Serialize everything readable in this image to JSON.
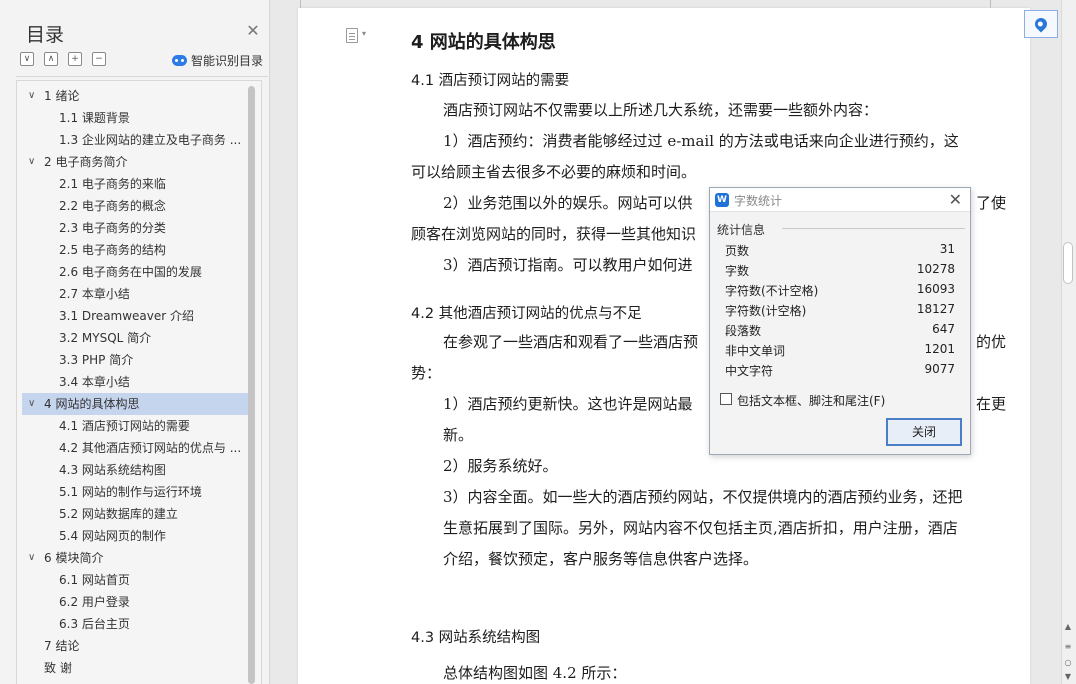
{
  "sidebar": {
    "title": "目录",
    "close_icon": "close-icon",
    "tools": [
      "expand-all-icon",
      "collapse-level-icon",
      "add-heading-icon",
      "remove-heading-icon"
    ],
    "smart_label": "智能识别目录",
    "items": [
      {
        "label": "1   绪论",
        "level": 1,
        "caret": "∨"
      },
      {
        "label": "1.1  课题背景",
        "level": 2
      },
      {
        "label": "1.3  企业网站的建立及电子商务 ...",
        "level": 2
      },
      {
        "label": "2   电子商务简介",
        "level": 1,
        "caret": "∨"
      },
      {
        "label": "2.1  电子商务的来临",
        "level": 2
      },
      {
        "label": "2.2  电子商务的概念",
        "level": 2
      },
      {
        "label": "2.3  电子商务的分类",
        "level": 2
      },
      {
        "label": "2.5  电子商务的结构",
        "level": 2
      },
      {
        "label": "2.6  电子商务在中国的发展",
        "level": 2
      },
      {
        "label": "2.7  本章小结",
        "level": 2
      },
      {
        "label": "3.1    Dreamweaver 介绍",
        "level": 2
      },
      {
        "label": "3.2    MYSQL 简介",
        "level": 2
      },
      {
        "label": "3.3 PHP 简介",
        "level": 2
      },
      {
        "label": "3.4  本章小结",
        "level": 2
      },
      {
        "label": "4   网站的具体构思",
        "level": 1,
        "caret": "∨",
        "selected": true
      },
      {
        "label": "4.1  酒店预订网站的需要",
        "level": 2
      },
      {
        "label": "4.2  其他酒店预订网站的优点与 ...",
        "level": 2
      },
      {
        "label": "4.3  网站系统结构图",
        "level": 2
      },
      {
        "label": "5.1  网站的制作与运行环境",
        "level": 2
      },
      {
        "label": "5.2  网站数据库的建立",
        "level": 2
      },
      {
        "label": "5.4  网站网页的制作",
        "level": 2
      },
      {
        "label": "6  模块简介",
        "level": 1,
        "caret": "∨"
      },
      {
        "label": "6.1  网站首页",
        "level": 2
      },
      {
        "label": "6.2  用户登录",
        "level": 2
      },
      {
        "label": "6.3 后台主页",
        "level": 2
      },
      {
        "label": "7  结论",
        "level": 1
      },
      {
        "label": "致   谢",
        "level": 1
      }
    ]
  },
  "document": {
    "chapter_title": "4   网站的具体构思",
    "s41_title": "4.1  酒店预订网站的需要",
    "p1": "酒店预订网站不仅需要以上所述几大系统，还需要一些额外内容：",
    "p2a": "1）酒店预约：消费者能够经过过 e-mail 的方法或电话来向企业进行预约，这",
    "p2b": "可以给顾主省去很多不必要的麻烦和时间。",
    "p3a": "2）业务范围以外的娱乐。网站可以供",
    "p3a_tail": "了使",
    "p3b": "顾客在浏览网站的同时，获得一些其他知识",
    "p4": "3）酒店预订指南。可以教用户如何进",
    "s42_title": "4.2  其他酒店预订网站的优点与不足",
    "p5a": "在参观了一些酒店和观看了一些酒店预",
    "p5a_tail": "的优",
    "p5b": "势：",
    "p6a": "1）酒店预约更新快。这也许是网站最",
    "p6a_tail": "在更",
    "p6b": "新。",
    "p7": "2）服务系统好。",
    "p8a": "3）内容全面。如一些大的酒店预约网站，不仅提供境内的酒店预约业务，还把",
    "p8b": "生意拓展到了国际。另外，网站内容不仅包括主页,酒店折扣，用户注册，酒店",
    "p8c": "介绍，餐饮预定，客户服务等信息供客户选择。",
    "s43_title": "4.3  网站系统结构图",
    "p9": "总体结构图如图 4.2 所示："
  },
  "dialog": {
    "logo": "W",
    "title": "字数统计",
    "section": "统计信息",
    "stats": [
      {
        "label": "页数",
        "value": "31"
      },
      {
        "label": "字数",
        "value": "10278"
      },
      {
        "label": "字符数(不计空格)",
        "value": "16093"
      },
      {
        "label": "字符数(计空格)",
        "value": "18127"
      },
      {
        "label": "段落数",
        "value": "647"
      },
      {
        "label": "非中文单词",
        "value": "1201"
      },
      {
        "label": "中文字符",
        "value": "9077"
      }
    ],
    "checkbox_label": "包括文本框、脚注和尾注(F)",
    "checkbox_checked": false,
    "close_button": "关闭"
  },
  "colors": {
    "selected_row": "#c6d5ee",
    "accent_blue": "#2a77d6"
  }
}
